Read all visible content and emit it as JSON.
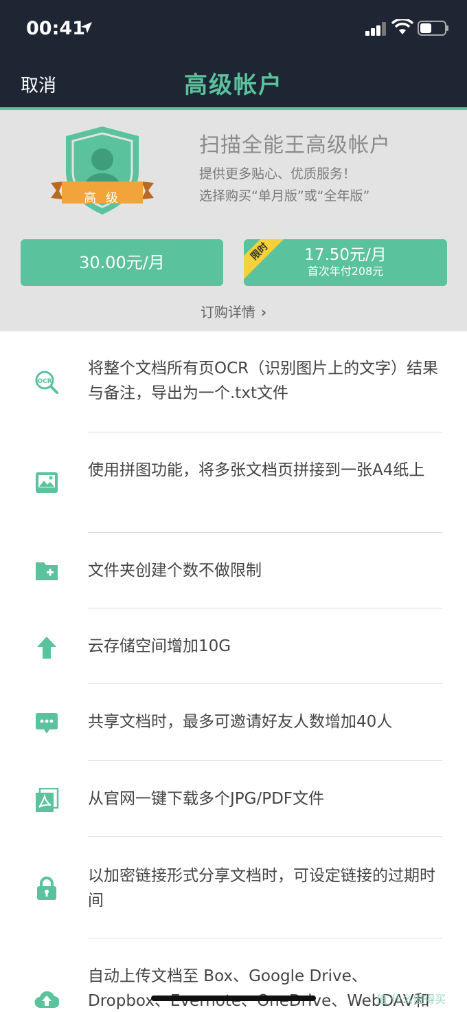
{
  "status_bar": {
    "time": "00:41"
  },
  "nav": {
    "cancel": "取消",
    "title": "高级帐户"
  },
  "promo": {
    "badge_label": "高 级",
    "title": "扫描全能王高级帐户",
    "subtitle1": "提供更多贴心、优质服务！",
    "subtitle2": "选择购买“单月版”或“全年版”",
    "monthly_price": "30.00元/月",
    "yearly_tag": "限时",
    "yearly_price": "17.50元/月",
    "yearly_note": "首次年付208元",
    "order_details": "订购详情"
  },
  "features": [
    {
      "icon": "ocr-search-icon",
      "text": "将整个文档所有页OCR（识别图片上的文字）结果与备注，导出为一个.txt文件"
    },
    {
      "icon": "collage-image-icon",
      "text": "使用拼图功能，将多张文档页拼接到一张A4纸上"
    },
    {
      "icon": "folder-add-icon",
      "text": "文件夹创建个数不做限制"
    },
    {
      "icon": "upload-arrow-icon",
      "text": "云存储空间增加10G"
    },
    {
      "icon": "chat-bubble-icon",
      "text": "共享文档时，最多可邀请好友人数增加40人"
    },
    {
      "icon": "pdf-document-icon",
      "text": "从官网一键下载多个JPG/PDF文件"
    },
    {
      "icon": "lock-icon",
      "text": "以加密链接形式分享文档时，可设定链接的过期时间"
    },
    {
      "icon": "cloud-upload-icon",
      "text": "自动上传文档至 Box、Google Drive、Dropbox、Evernote、OneDrive、WebDAV和"
    }
  ],
  "watermark": "值 什么值得买",
  "colors": {
    "accent": "#5ac29c",
    "header_bg": "#1f2633",
    "promo_bg": "#e3e3e3",
    "ribbon": "#f5d23a",
    "badge_banner": "#f2a33a"
  }
}
